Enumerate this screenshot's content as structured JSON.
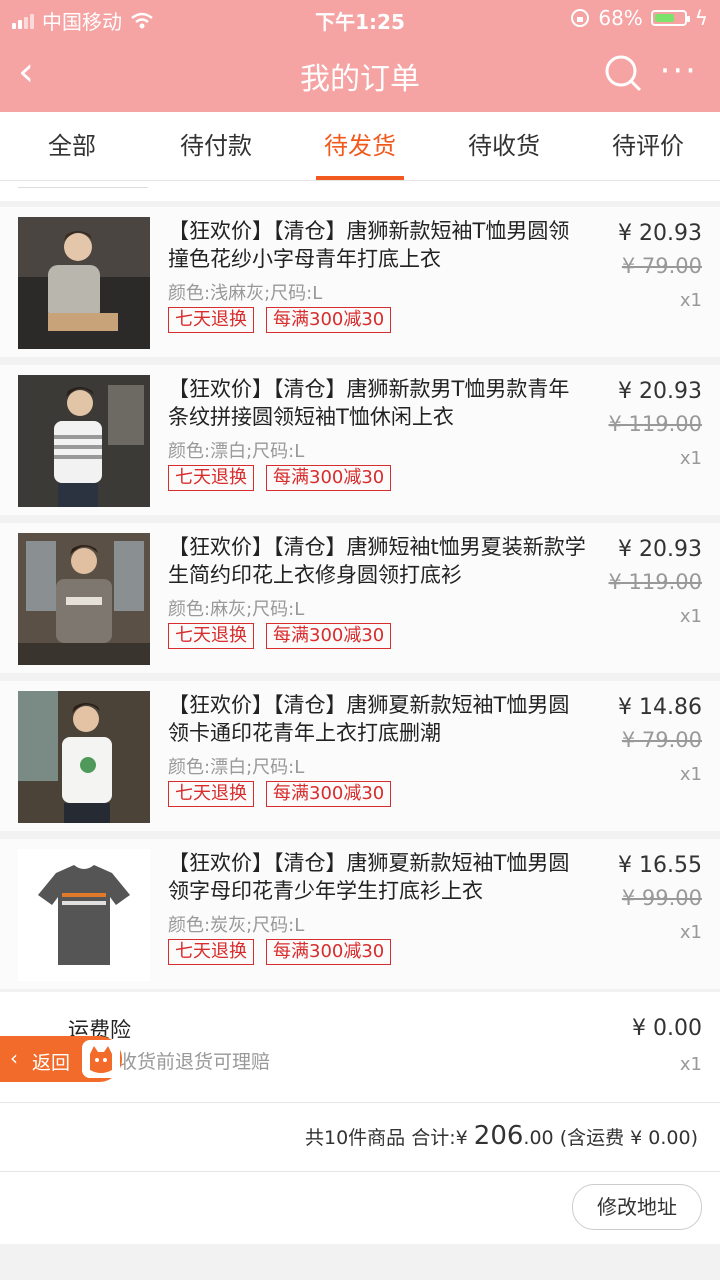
{
  "status_bar": {
    "carrier": "中国移动",
    "time": "下午1:25",
    "battery": "68%",
    "battery_level": 0.68
  },
  "nav": {
    "title": "我的订单"
  },
  "tabs": [
    {
      "label": "全部"
    },
    {
      "label": "待付款"
    },
    {
      "label": "待发货",
      "active": true
    },
    {
      "label": "待收货"
    },
    {
      "label": "待评价"
    }
  ],
  "items": [
    {
      "title": "【狂欢价】【清仓】唐狮新款短袖T恤男圆领撞色花纱小字母青年打底上衣",
      "attr": "颜色:浅麻灰;尺码:L",
      "tags": [
        "七天退换",
        "每满300减30"
      ],
      "price": "¥ 20.93",
      "old_price": "¥ 79.00",
      "qty": "x1"
    },
    {
      "title": "【狂欢价】【清仓】唐狮新款男T恤男款青年条纹拼接圆领短袖T恤休闲上衣",
      "attr": "颜色:漂白;尺码:L",
      "tags": [
        "七天退换",
        "每满300减30"
      ],
      "price": "¥ 20.93",
      "old_price": "¥ 119.00",
      "qty": "x1"
    },
    {
      "title": "【狂欢价】【清仓】唐狮短袖t恤男夏装新款学生简约印花上衣修身圆领打底衫",
      "attr": "颜色:麻灰;尺码:L",
      "tags": [
        "七天退换",
        "每满300减30"
      ],
      "price": "¥ 20.93",
      "old_price": "¥ 119.00",
      "qty": "x1"
    },
    {
      "title": "【狂欢价】【清仓】唐狮夏新款短袖T恤男圆领卡通印花青年上衣打底删潮",
      "attr": "颜色:漂白;尺码:L",
      "tags": [
        "七天退换",
        "每满300减30"
      ],
      "price": "¥ 14.86",
      "old_price": "¥ 79.00",
      "qty": "x1"
    },
    {
      "title": "【狂欢价】【清仓】唐狮夏新款短袖T恤男圆领字母印花青少年学生打底衫上衣",
      "attr": "颜色:炭灰;尺码:L",
      "tags": [
        "七天退换",
        "每满300减30"
      ],
      "price": "¥ 16.55",
      "old_price": "¥ 99.00",
      "qty": "x1"
    }
  ],
  "insurance": {
    "name": "运费险",
    "desc": "收货前退货可理赔",
    "price": "¥ 0.00",
    "qty": "x1"
  },
  "back_button": {
    "label": "返回"
  },
  "summary": {
    "count_text": "共10件商品",
    "total_label": "合计:",
    "currency": "¥",
    "amount_int": "206",
    "amount_dec": ".00",
    "shipping": "(含运费 ¥ 0.00)"
  },
  "actions": {
    "modify_address": "修改地址"
  }
}
